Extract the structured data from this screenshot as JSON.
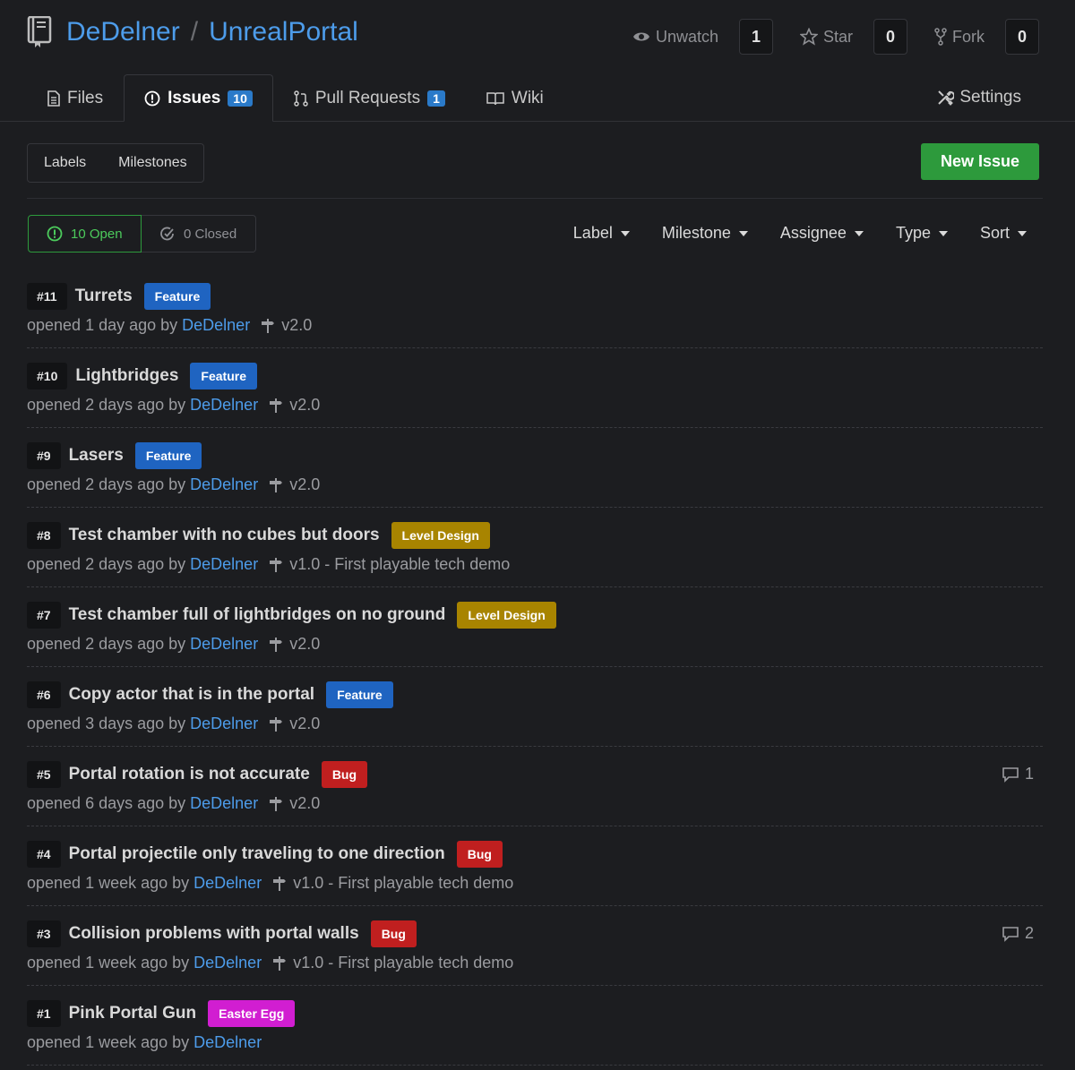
{
  "repo": {
    "owner": "DeDelner",
    "separator": "/",
    "name": "UnrealPortal"
  },
  "actions": {
    "watch": {
      "label": "Unwatch",
      "count": "1"
    },
    "star": {
      "label": "Star",
      "count": "0"
    },
    "fork": {
      "label": "Fork",
      "count": "0"
    }
  },
  "tabs": {
    "files": "Files",
    "issues": {
      "label": "Issues",
      "badge": "10"
    },
    "pulls": {
      "label": "Pull Requests",
      "badge": "1"
    },
    "wiki": "Wiki",
    "settings": "Settings"
  },
  "toolbar": {
    "labels": "Labels",
    "milestones": "Milestones",
    "new_issue": "New Issue"
  },
  "state": {
    "open": "10 Open",
    "closed": "0 Closed"
  },
  "filters": [
    "Label",
    "Milestone",
    "Assignee",
    "Type",
    "Sort"
  ],
  "colors": {
    "feature": "#1f64c1",
    "level_design": "#a88400",
    "bug": "#c01f1f",
    "easter_egg": "#d11ed1"
  },
  "issues": [
    {
      "num": "#11",
      "title": "Turrets",
      "label": "Feature",
      "label_color": "#1f64c1",
      "when": "opened 1 day ago by",
      "author": "DeDelner",
      "milestone": "v2.0",
      "comments": ""
    },
    {
      "num": "#10",
      "title": "Lightbridges",
      "label": "Feature",
      "label_color": "#1f64c1",
      "when": "opened 2 days ago by",
      "author": "DeDelner",
      "milestone": "v2.0",
      "comments": ""
    },
    {
      "num": "#9",
      "title": "Lasers",
      "label": "Feature",
      "label_color": "#1f64c1",
      "when": "opened 2 days ago by",
      "author": "DeDelner",
      "milestone": "v2.0",
      "comments": ""
    },
    {
      "num": "#8",
      "title": "Test chamber with no cubes but doors",
      "label": "Level Design",
      "label_color": "#a88400",
      "when": "opened 2 days ago by",
      "author": "DeDelner",
      "milestone": "v1.0 - First playable tech demo",
      "comments": ""
    },
    {
      "num": "#7",
      "title": "Test chamber full of lightbridges on no ground",
      "label": "Level Design",
      "label_color": "#a88400",
      "when": "opened 2 days ago by",
      "author": "DeDelner",
      "milestone": "v2.0",
      "comments": ""
    },
    {
      "num": "#6",
      "title": "Copy actor that is in the portal",
      "label": "Feature",
      "label_color": "#1f64c1",
      "when": "opened 3 days ago by",
      "author": "DeDelner",
      "milestone": "v2.0",
      "comments": ""
    },
    {
      "num": "#5",
      "title": "Portal rotation is not accurate",
      "label": "Bug",
      "label_color": "#c01f1f",
      "when": "opened 6 days ago by",
      "author": "DeDelner",
      "milestone": "v2.0",
      "comments": "1"
    },
    {
      "num": "#4",
      "title": "Portal projectile only traveling to one direction",
      "label": "Bug",
      "label_color": "#c01f1f",
      "when": "opened 1 week ago by",
      "author": "DeDelner",
      "milestone": "v1.0 - First playable tech demo",
      "comments": ""
    },
    {
      "num": "#3",
      "title": "Collision problems with portal walls",
      "label": "Bug",
      "label_color": "#c01f1f",
      "when": "opened 1 week ago by",
      "author": "DeDelner",
      "milestone": "v1.0 - First playable tech demo",
      "comments": "2"
    },
    {
      "num": "#1",
      "title": "Pink Portal Gun",
      "label": "Easter Egg",
      "label_color": "#d11ed1",
      "when": "opened 1 week ago by",
      "author": "DeDelner",
      "milestone": "",
      "comments": ""
    }
  ]
}
